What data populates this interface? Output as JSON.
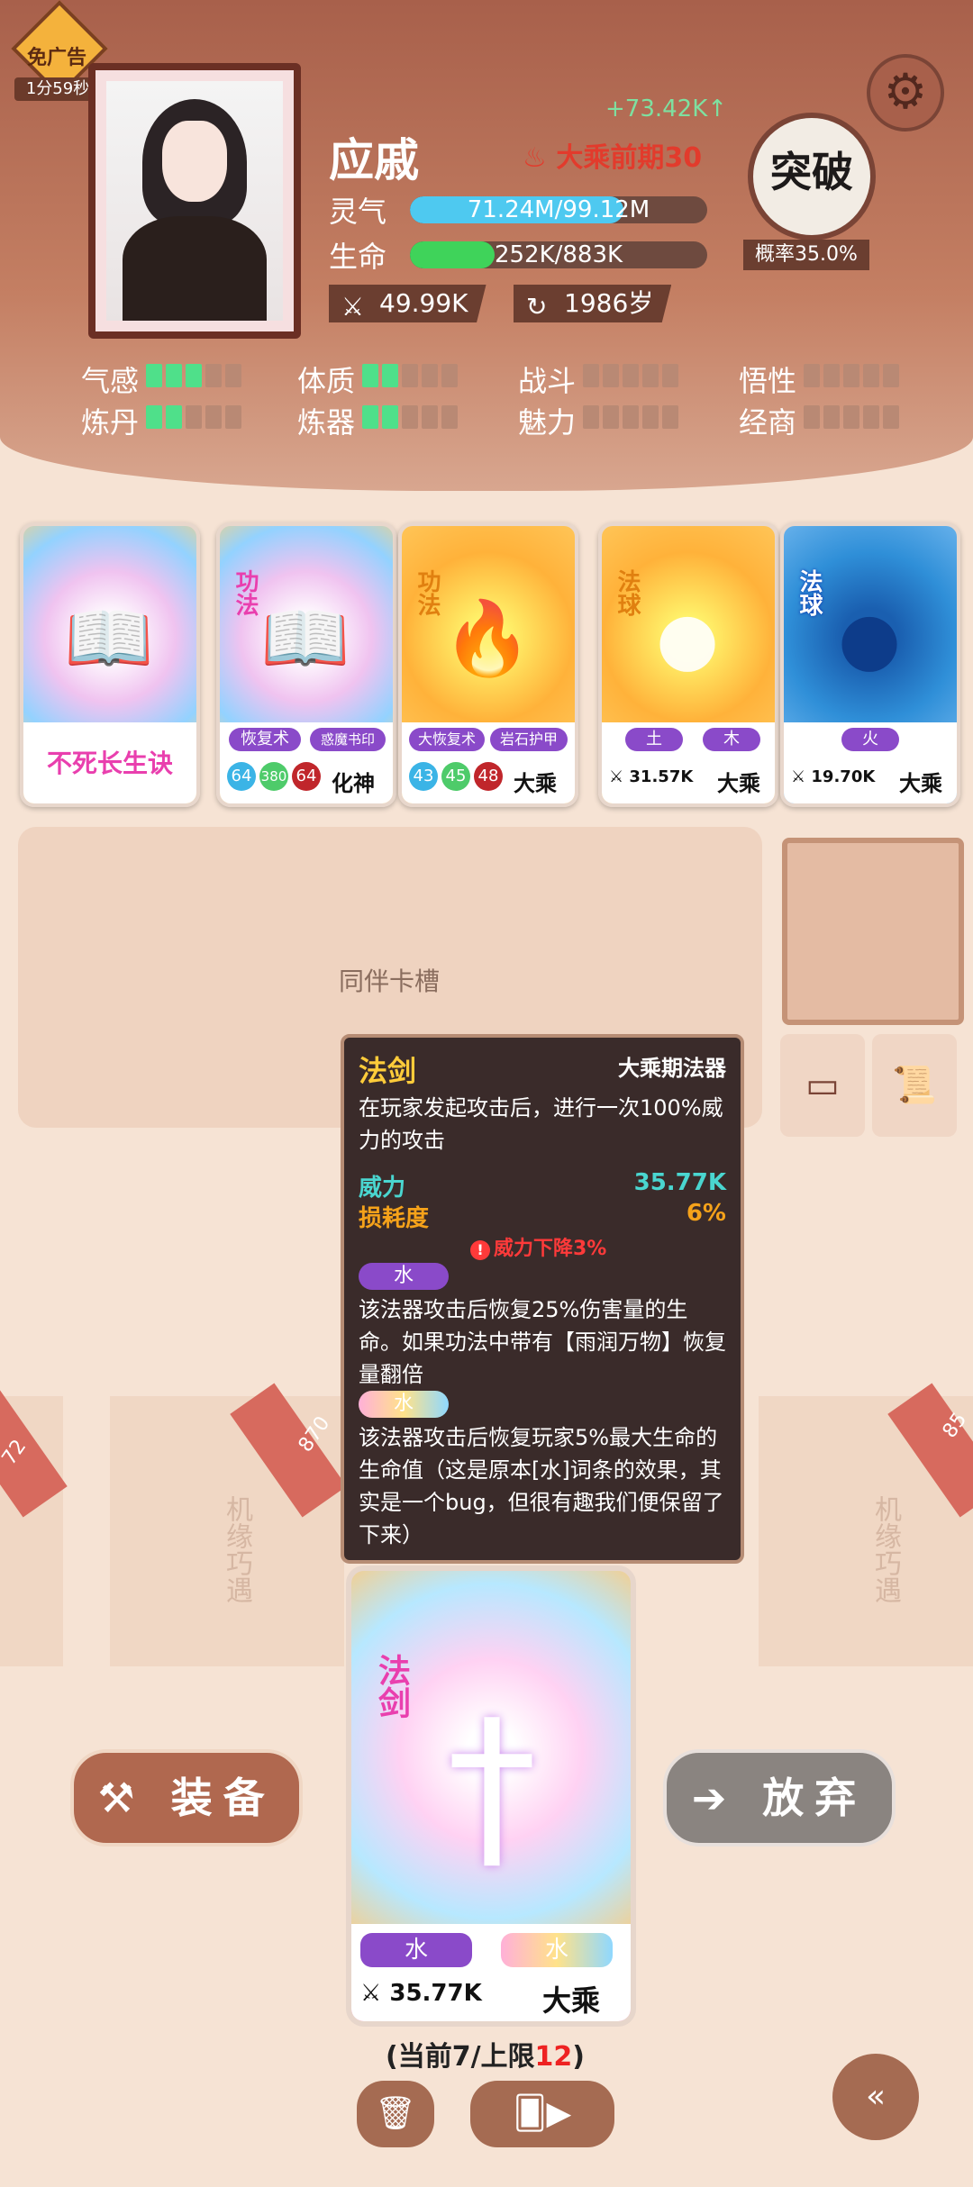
{
  "header": {
    "ad_label": "免广告",
    "ad_timer": "1分59秒",
    "name": "应戚",
    "gain": "+73.42K↑",
    "realm": "大乘前期30",
    "breakthrough_label": "突破",
    "breakthrough_rate": "概率35.0%",
    "spirit_label": "灵气",
    "spirit_value": "71.24M/99.12M",
    "spirit_fraction": 0.719,
    "life_label": "生命",
    "life_value": "252K/883K",
    "life_fraction": 0.285,
    "attack": "49.99K",
    "age": "1986岁"
  },
  "attributes": [
    {
      "label": "气感",
      "on": 3
    },
    {
      "label": "体质",
      "on": 2
    },
    {
      "label": "战斗",
      "on": 0
    },
    {
      "label": "悟性",
      "on": 0
    },
    {
      "label": "炼丹",
      "on": 2
    },
    {
      "label": "炼器",
      "on": 2
    },
    {
      "label": "魅力",
      "on": 0
    },
    {
      "label": "经商",
      "on": 0
    }
  ],
  "cards": [
    {
      "kind": "",
      "name": "不死长生诀"
    },
    {
      "kind": "功法",
      "tag1": "恢复术",
      "tag2": "惑魔书印",
      "n1": "64",
      "n2": "380",
      "n3": "64",
      "realm": "化神"
    },
    {
      "kind": "功法",
      "tag1": "大恢复术",
      "tag2": "岩石护甲",
      "n1": "43",
      "n2": "45",
      "n3": "48",
      "realm": "大乘"
    },
    {
      "kind": "法球",
      "tag1": "土",
      "tag2": "木",
      "power": "31.57K",
      "realm": "大乘"
    },
    {
      "kind": "法球",
      "tag1": "火",
      "power": "19.70K",
      "realm": "大乘"
    }
  ],
  "companion_slot": "同伴卡槽",
  "bg_numbers": [
    "72",
    "870",
    "85"
  ],
  "bg_text": "机缘巧遇",
  "tooltip": {
    "title": "法剑",
    "grade": "大乘期法器",
    "desc": "在玩家发起攻击后，进行一次100%威力的攻击",
    "power_label": "威力",
    "power_value": "35.77K",
    "wear_label": "损耗度",
    "wear_value": "6%",
    "warning": "威力下降3%",
    "affix1": "水",
    "affix1_text": "该法器攻击后恢复25%伤害量的生命。如果功法中带有【雨润万物】恢复量翻倍",
    "affix2": "水",
    "affix2_text": "该法器攻击后恢复玩家5%最大生命的生命值（这是原本[水]词条的效果，其实是一个bug，但很有趣我们便保留了下来）"
  },
  "main_card": {
    "kind": "法剑",
    "tag1": "水",
    "tag2": "水",
    "power": "35.77K",
    "realm": "大乘"
  },
  "buttons": {
    "equip": "装备",
    "discard": "放弃"
  },
  "limit": {
    "prefix": "(当前7/上限",
    "max": "12",
    "suffix": ")"
  },
  "colors": {
    "accent": "#a8604b",
    "bar_spirit": "#4ec9f0",
    "bar_life": "#3fd35a",
    "pip_on": "#4fe08a"
  }
}
